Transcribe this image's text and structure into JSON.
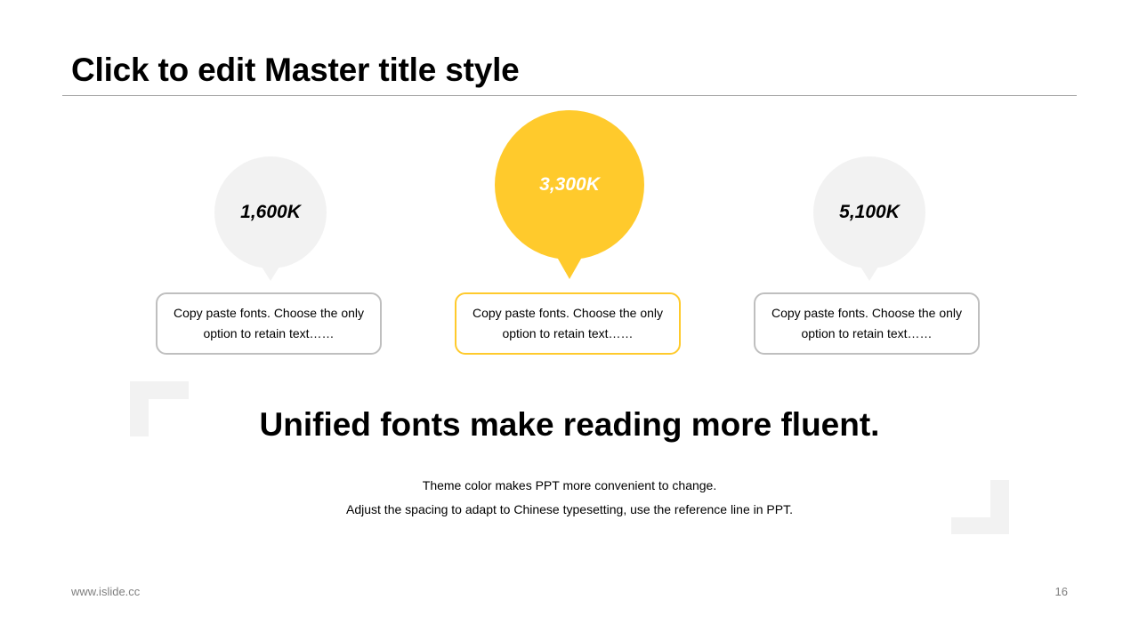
{
  "slide": {
    "title": "Click to edit Master title style",
    "page_number": "16",
    "footer_url": "www.islide.cc"
  },
  "bubbles": [
    {
      "value": "1,600K",
      "style": "grey",
      "color": "#f2f2f2"
    },
    {
      "value": "3,300K",
      "style": "yellow",
      "color": "#ffca2c"
    },
    {
      "value": "5,100K",
      "style": "grey",
      "color": "#f2f2f2"
    }
  ],
  "cards": [
    {
      "text": "Copy paste fonts. Choose the only option to retain text……"
    },
    {
      "text": "Copy paste fonts. Choose the only option to retain text……"
    },
    {
      "text": "Copy paste fonts. Choose the only option to retain text……"
    }
  ],
  "statement": {
    "heading": "Unified fonts make reading more fluent.",
    "line1": "Theme color makes PPT more convenient  to change.",
    "line2": "Adjust the spacing to adapt to Chinese  typesetting,  use the reference line  in PPT."
  },
  "colors": {
    "accent": "#ffca2c",
    "neutral": "#f2f2f2",
    "border": "#bfbfbf"
  }
}
